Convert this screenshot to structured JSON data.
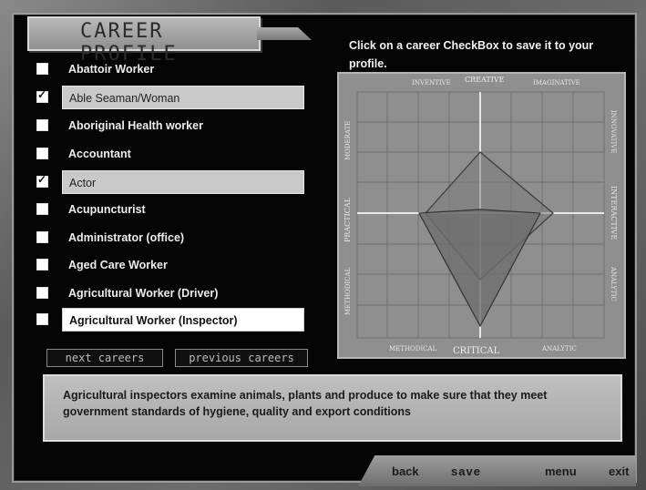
{
  "header": {
    "title": "CAREER PROFILE"
  },
  "instructions": "Click on a career CheckBox to save it to your profile.",
  "careers": [
    {
      "label": "Abattoir Worker",
      "checked": false,
      "state": "normal"
    },
    {
      "label": "Able Seaman/Woman",
      "checked": true,
      "state": "saved"
    },
    {
      "label": "Aboriginal Health worker",
      "checked": false,
      "state": "normal"
    },
    {
      "label": "Accountant",
      "checked": false,
      "state": "normal"
    },
    {
      "label": "Actor",
      "checked": true,
      "state": "saved"
    },
    {
      "label": "Acupuncturist",
      "checked": false,
      "state": "normal"
    },
    {
      "label": "Administrator (office)",
      "checked": false,
      "state": "normal"
    },
    {
      "label": "Aged Care Worker",
      "checked": false,
      "state": "normal"
    },
    {
      "label": "Agricultural Worker (Driver)",
      "checked": false,
      "state": "normal"
    },
    {
      "label": "Agricultural Worker (Inspector)",
      "checked": false,
      "state": "active"
    }
  ],
  "nav": {
    "next": "next careers",
    "previous": "previous careers"
  },
  "chart_labels": {
    "top_left": "INVENTIVE",
    "top": "CREATIVE",
    "top_right": "IMAGINATIVE",
    "right_top": "INNOVATIVE",
    "right_middle": "INTERACTIVE",
    "right_bottom": "ANALYTIC",
    "bottom_right": "ANALYTIC",
    "bottom": "CRITICAL",
    "bottom_left": "METHODICAL",
    "left_bottom": "METHODICAL",
    "left_middle": "PRACTICAL",
    "left_top": "MODERATE"
  },
  "description": "Agricultural inspectors examine animals, plants and produce to make sure that they meet government standards of hygiene, quality and export conditions",
  "footer": {
    "back": "back",
    "save": "save",
    "menu": "menu",
    "exit": "exit"
  },
  "colors": {
    "background": "#050505",
    "panel": "#8d8d8d",
    "accent_text": "#f2f2f2"
  }
}
